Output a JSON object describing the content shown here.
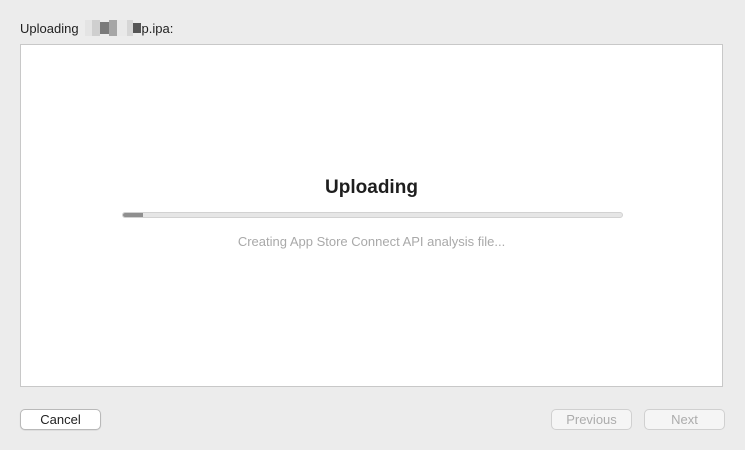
{
  "header": {
    "prefix": "Uploading",
    "filename_suffix": "p.ipa:"
  },
  "main": {
    "title": "Uploading",
    "progress_fraction": 0.04,
    "status": "Creating App Store Connect API analysis file..."
  },
  "footer": {
    "cancel_label": "Cancel",
    "previous_label": "Previous",
    "next_label": "Next"
  }
}
